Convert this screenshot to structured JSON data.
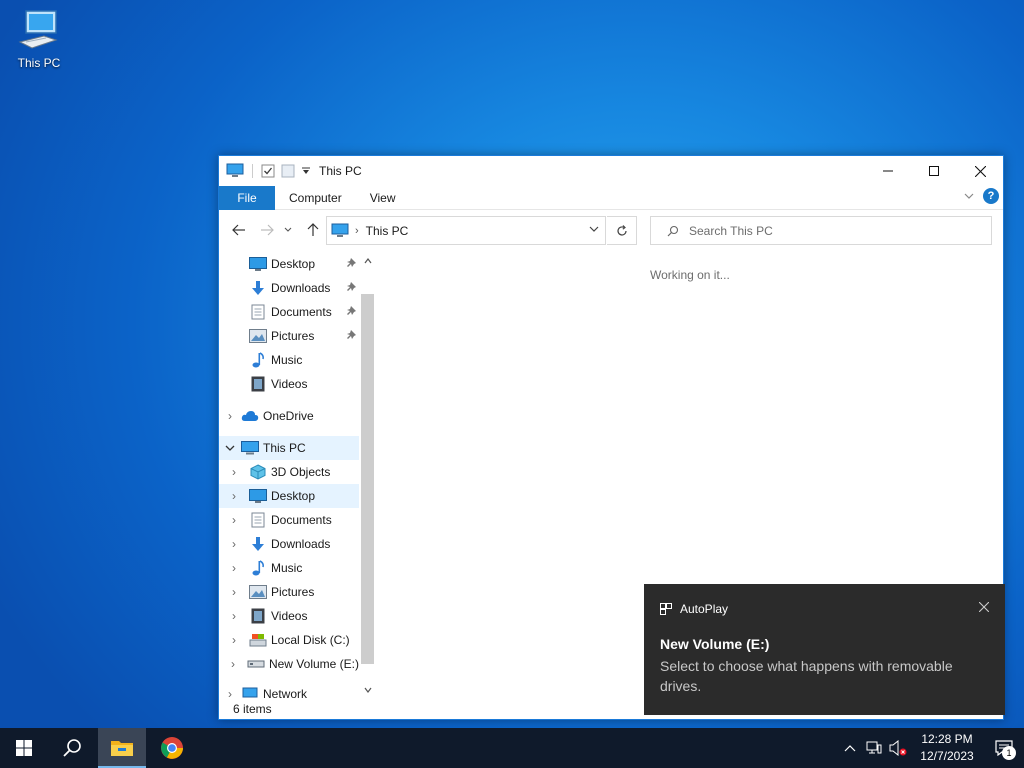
{
  "desktop": {
    "icon_label": "This PC"
  },
  "window": {
    "title": "This PC",
    "ribbon": {
      "tabs": [
        "File",
        "Computer",
        "View"
      ],
      "help": "?"
    },
    "address": {
      "path": "This PC"
    },
    "search": {
      "placeholder": "Search This PC"
    },
    "nav": {
      "quick_access": [
        {
          "label": "Desktop",
          "icon": "desktop-icon",
          "pinned": true
        },
        {
          "label": "Downloads",
          "icon": "downloads-icon",
          "pinned": true
        },
        {
          "label": "Documents",
          "icon": "documents-icon",
          "pinned": true
        },
        {
          "label": "Pictures",
          "icon": "pictures-icon",
          "pinned": true
        },
        {
          "label": "Music",
          "icon": "music-icon",
          "pinned": false
        },
        {
          "label": "Videos",
          "icon": "videos-icon",
          "pinned": false
        }
      ],
      "onedrive": "OneDrive",
      "this_pc": "This PC",
      "this_pc_children": [
        {
          "label": "3D Objects",
          "icon": "3d-objects-icon"
        },
        {
          "label": "Desktop",
          "icon": "desktop-icon"
        },
        {
          "label": "Documents",
          "icon": "documents-icon"
        },
        {
          "label": "Downloads",
          "icon": "downloads-icon"
        },
        {
          "label": "Music",
          "icon": "music-icon"
        },
        {
          "label": "Pictures",
          "icon": "pictures-icon"
        },
        {
          "label": "Videos",
          "icon": "videos-icon"
        },
        {
          "label": "Local Disk (C:)",
          "icon": "local-disk-icon"
        },
        {
          "label": "New Volume (E:)",
          "icon": "removable-drive-icon"
        }
      ],
      "network": "Network"
    },
    "content_message": "Working on it...",
    "status": "6 items"
  },
  "toast": {
    "app": "AutoPlay",
    "title": "New Volume (E:)",
    "body": "Select to choose what happens with removable drives."
  },
  "taskbar": {
    "time": "12:28 PM",
    "date": "12/7/2023",
    "notification_count": "1"
  },
  "colors": {
    "accent": "#1979ca",
    "selection": "#e5f3ff",
    "taskbar": "#0f1a2b",
    "toast": "#2b2b2b"
  }
}
